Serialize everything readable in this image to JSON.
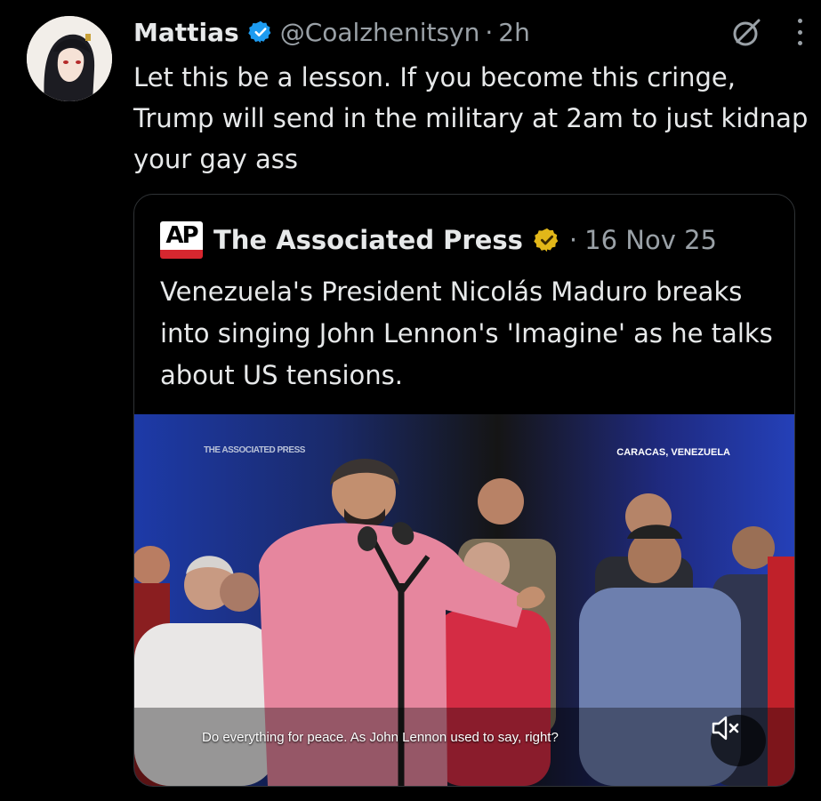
{
  "tweet": {
    "author_name": "Mattias",
    "handle": "@Coalzhenitsyn",
    "separator": "·",
    "time": "2h",
    "text": "Let this be a lesson. If you become this cringe, Trump will send in the military at 2am to just kidnap your gay ass",
    "icons": {
      "verified": "verified-badge-icon",
      "grok": "grok-icon",
      "more": "more-options-icon",
      "avatar": "avatar"
    }
  },
  "quote": {
    "logo_text": "AP",
    "author_name": "The Associated Press",
    "separator": "·",
    "date": "16 Nov 25",
    "text": "Venezuela's President Nicolás Maduro breaks into singing John Lennon's 'Imagine' as he talks about US tensions.",
    "media": {
      "watermark": "THE ASSOCIATED PRESS",
      "location": "CARACAS, VENEZUELA",
      "caption": "Do everything for peace. As John Lennon used to say, right?",
      "mute_icon": "speaker-muted-icon"
    }
  },
  "colors": {
    "background": "#000000",
    "text": "#e7e9ea",
    "secondary": "#9aa1a7",
    "verified_blue": "#1d9bf0",
    "gold_badge": "#e2b719",
    "ap_red": "#d7272f",
    "border": "#2f3336"
  }
}
